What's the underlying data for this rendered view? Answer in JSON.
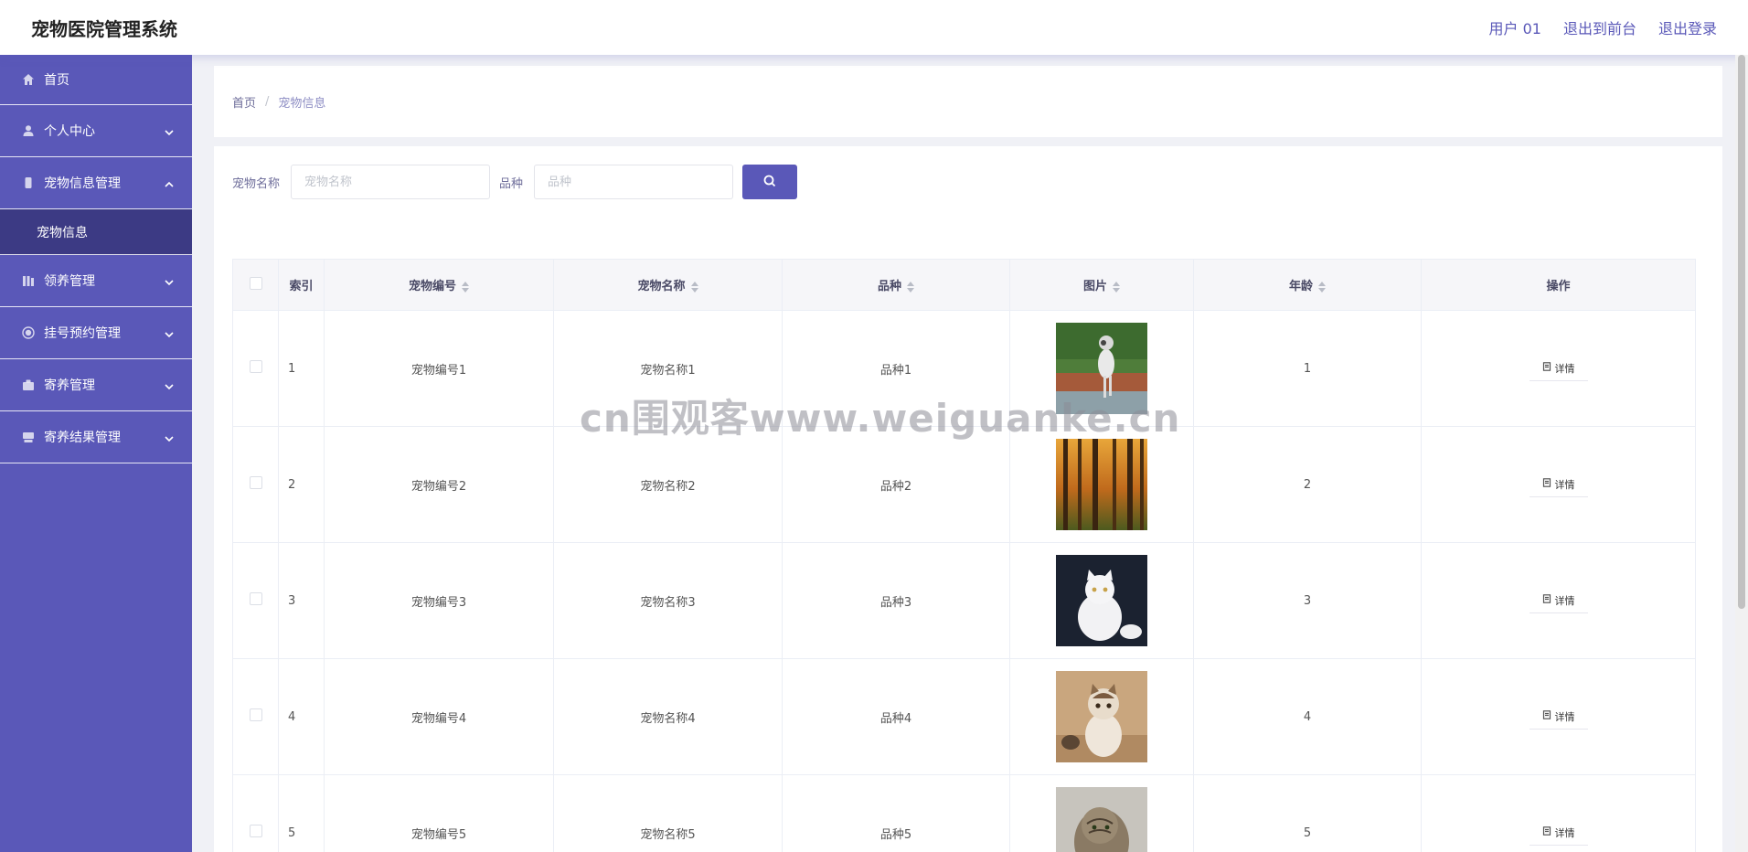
{
  "header": {
    "title": "宠物医院管理系统",
    "links": [
      "用户 01",
      "退出到前台",
      "退出登录"
    ]
  },
  "sidebar": {
    "items": [
      {
        "label": "首页",
        "icon": "home-icon",
        "expanded": false
      },
      {
        "label": "个人中心",
        "icon": "user-icon",
        "expanded": false
      },
      {
        "label": "宠物信息管理",
        "icon": "pet-info-icon",
        "expanded": true,
        "children": [
          "宠物信息"
        ]
      },
      {
        "label": "领养管理",
        "icon": "adoption-icon",
        "expanded": false
      },
      {
        "label": "挂号预约管理",
        "icon": "appointment-icon",
        "expanded": false
      },
      {
        "label": "寄养管理",
        "icon": "boarding-icon",
        "expanded": false
      },
      {
        "label": "寄养结果管理",
        "icon": "result-icon",
        "expanded": false
      }
    ]
  },
  "breadcrumb": {
    "home": "首页",
    "separator": "/",
    "current": "宠物信息"
  },
  "search": {
    "name_label": "宠物名称",
    "name_placeholder": "宠物名称",
    "breed_label": "品种",
    "breed_placeholder": "品种"
  },
  "table": {
    "columns": [
      "索引",
      "宠物编号",
      "宠物名称",
      "品种",
      "图片",
      "年龄",
      "操作"
    ],
    "rows": [
      {
        "index": "1",
        "code": "宠物编号1",
        "name": "宠物名称1",
        "breed": "品种1",
        "image": "dog-running",
        "age": "1",
        "action": "详情"
      },
      {
        "index": "2",
        "code": "宠物编号2",
        "name": "宠物名称2",
        "breed": "品种2",
        "image": "forest",
        "age": "2",
        "action": "详情"
      },
      {
        "index": "3",
        "code": "宠物编号3",
        "name": "宠物名称3",
        "breed": "品种3",
        "image": "white-cat",
        "age": "3",
        "action": "详情"
      },
      {
        "index": "4",
        "code": "宠物编号4",
        "name": "宠物名称4",
        "breed": "品种4",
        "image": "exotic-cat",
        "age": "4",
        "action": "详情"
      },
      {
        "index": "5",
        "code": "宠物编号5",
        "name": "宠物名称5",
        "breed": "品种5",
        "image": "tabby-cat",
        "age": "5",
        "action": "详情"
      }
    ]
  },
  "watermark": "cn围观客www.weiguanke.cn",
  "colors": {
    "accent": "#5a58b8",
    "submenu_active": "#3c3a84"
  }
}
